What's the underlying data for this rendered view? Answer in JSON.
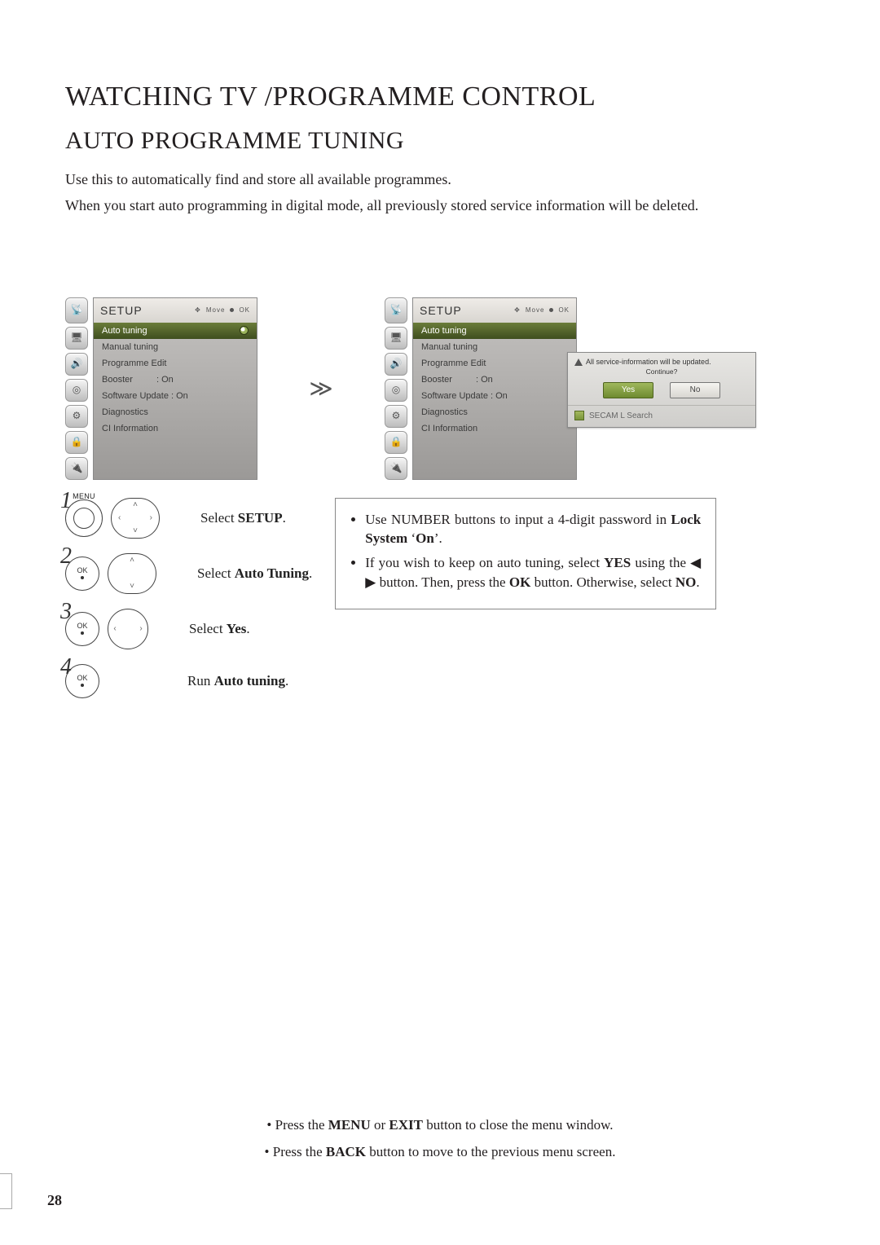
{
  "page": {
    "number": "28",
    "h1": "WATCHING TV /PROGRAMME CONTROL",
    "h2": "AUTO PROGRAMME TUNING",
    "intro1": "Use this to automatically find and store all available programmes.",
    "intro2": "When you start auto programming in digital mode, all previously stored service information will be deleted."
  },
  "screen": {
    "title": "SETUP",
    "hint_move": "Move",
    "hint_ok": "OK",
    "items": [
      "Auto tuning",
      "Manual tuning",
      "Programme Edit",
      "Booster",
      "Software Update : On",
      "Diagnostics",
      "CI Information"
    ],
    "booster_value": ": On"
  },
  "dialog": {
    "message": "All service-information will be updated.",
    "continue": "Continue?",
    "yes": "Yes",
    "no": "No",
    "secam": "SECAM L Search"
  },
  "steps": {
    "menu_label": "MENU",
    "ok_label": "OK",
    "s1_prefix": "Select ",
    "s1_bold": "SETUP",
    "s1_suffix": ".",
    "s2_prefix": "Select ",
    "s2_bold": "Auto Tuning",
    "s2_suffix": ".",
    "s3_prefix": "Select ",
    "s3_bold": "Yes",
    "s3_suffix": ".",
    "s4_prefix": "Run ",
    "s4_bold": "Auto tuning",
    "s4_suffix": "."
  },
  "tips": {
    "t1_a": "Use NUMBER buttons to input a 4-digit password in ",
    "t1_b": "Lock System",
    "t1_c": " ‘",
    "t1_d": "On",
    "t1_e": "’.",
    "t2_a": "If you wish to keep on auto tuning, select ",
    "t2_b": "YES",
    "t2_c": " using the ◀ ▶ button. Then, press the ",
    "t2_d": "OK",
    "t2_e": " button. Otherwise, select ",
    "t2_f": "NO",
    "t2_g": "."
  },
  "footer": {
    "f1_a": "• Press the ",
    "f1_b": "MENU",
    "f1_c": " or ",
    "f1_d": "EXIT",
    "f1_e": " button to close the menu window.",
    "f2_a": "• Press the ",
    "f2_b": "BACK",
    "f2_c": " button to move to the previous menu screen."
  }
}
